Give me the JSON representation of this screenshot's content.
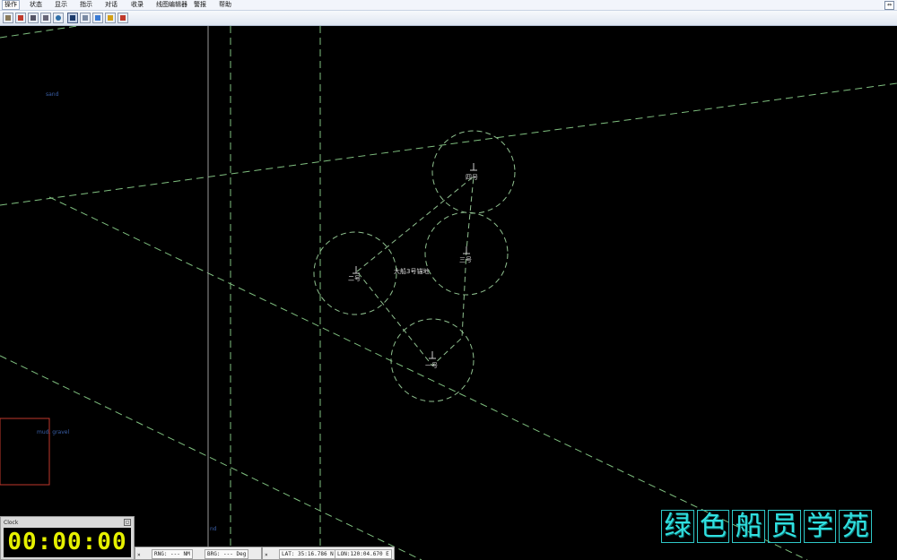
{
  "menu": {
    "items": [
      "操作",
      "状态",
      "显示",
      "指示",
      "对话",
      "收录",
      "线图编辑器",
      "警报",
      "帮助"
    ]
  },
  "chart": {
    "labels": {
      "sand": "sand",
      "mud_gravel": "mud, gravel",
      "nd": "nd",
      "buoy_1": "一号",
      "buoy_2": "二号",
      "buoy_3": "三号",
      "buoy_4": "四号",
      "area_name": "大船3号锚地"
    },
    "colors": {
      "background": "#000000",
      "dashed_line": "#7fbf7f",
      "buoy_circle": "#8fc08f",
      "depth_label": "#3a5fa8",
      "box": "#c0392b"
    }
  },
  "clock": {
    "title": "Clock",
    "time": "00:00:00"
  },
  "status": {
    "rng": "RNG: --- NM",
    "brg": "BRG: --- Deg",
    "lat": "LAT: 35:16.786 N",
    "lon": "LON:120:04.670 E"
  },
  "watermark": {
    "chars": [
      "绿",
      "色",
      "船",
      "员",
      "学",
      "苑"
    ]
  }
}
